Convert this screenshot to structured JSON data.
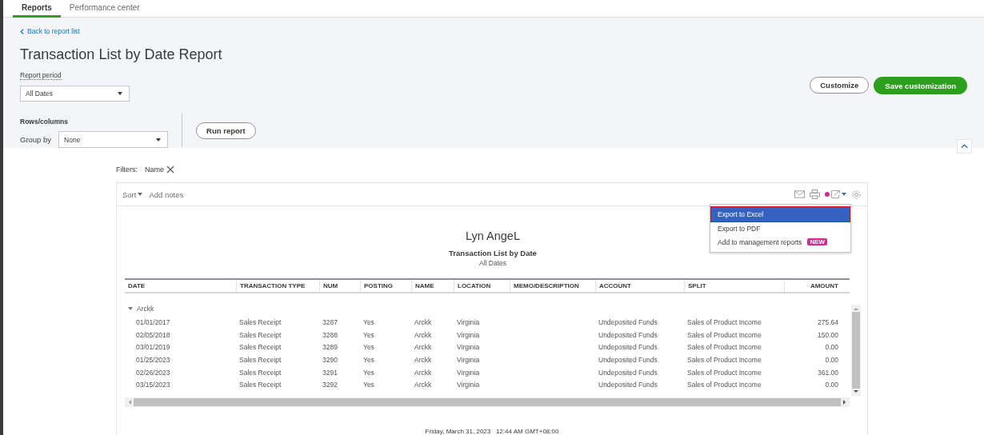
{
  "tabs": [
    {
      "label": "Reports",
      "selected": true
    },
    {
      "label": "Performance center",
      "selected": false
    }
  ],
  "back_link": "Back to report list",
  "title": "Transaction List by Date Report",
  "report_period": {
    "label": "Report period",
    "value": "All Dates"
  },
  "rows_columns": {
    "label": "Rows/columns",
    "group_by_label": "Group by",
    "group_by_value": "None"
  },
  "run_report": "Run report",
  "customize": "Customize",
  "save_customization": "Save customization",
  "filters": {
    "label": "Filters:",
    "items": [
      "Name"
    ]
  },
  "toolbar": {
    "sort": "Sort",
    "add_notes": "Add notes",
    "export_notification": true
  },
  "export_menu": [
    {
      "label": "Export to Excel",
      "selected": true
    },
    {
      "label": "Export to PDF",
      "selected": false
    },
    {
      "label": "Add to management reports",
      "selected": false,
      "badge": "NEW"
    }
  ],
  "report": {
    "company": "Lyn AngeL",
    "name": "Transaction List by Date",
    "period": "All Dates"
  },
  "table": {
    "columns": [
      "DATE",
      "TRANSACTION TYPE",
      "NUM",
      "POSTING",
      "NAME",
      "LOCATION",
      "MEMO/DESCRIPTION",
      "ACCOUNT",
      "SPLIT",
      "AMOUNT"
    ],
    "groups": [
      {
        "label": "Arckk",
        "expanded": true,
        "rows": [
          [
            "01/01/2017",
            "Sales Receipt",
            "3287",
            "Yes",
            "Arckk",
            "Virginia",
            "",
            "Undeposited Funds",
            "Sales of Product Income",
            "275.64"
          ],
          [
            "02/05/2018",
            "Sales Receipt",
            "3288",
            "Yes",
            "Arckk",
            "Virginia",
            "",
            "Undeposited Funds",
            "Sales of Product Income",
            "150.00"
          ],
          [
            "03/01/2019",
            "Sales Receipt",
            "3289",
            "Yes",
            "Arckk",
            "Virginia",
            "",
            "Undeposited Funds",
            "Sales of Product Income",
            "0.00"
          ],
          [
            "01/25/2023",
            "Sales Receipt",
            "3290",
            "Yes",
            "Arckk",
            "Virginia",
            "",
            "Undeposited Funds",
            "Sales of Product Income",
            "0.00"
          ],
          [
            "02/26/2023",
            "Sales Receipt",
            "3291",
            "Yes",
            "Arckk",
            "Virginia",
            "",
            "Undeposited Funds",
            "Sales of Product Income",
            "361.00"
          ],
          [
            "03/15/2023",
            "Sales Receipt",
            "3292",
            "Yes",
            "Arckk",
            "Virginia",
            "",
            "Undeposited Funds",
            "Sales of Product Income",
            "0.00"
          ]
        ]
      }
    ]
  },
  "footer": "Friday, March 31, 2023   12:44 AM GMT+08:00"
}
